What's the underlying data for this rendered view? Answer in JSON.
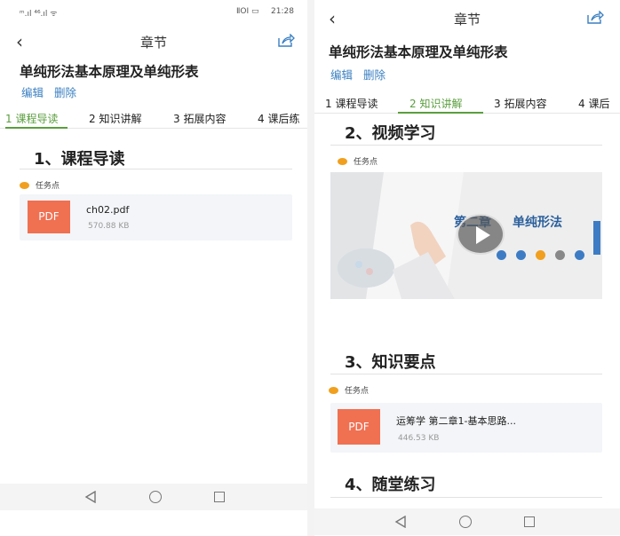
{
  "left": {
    "status": {
      "left_icons": "ᵐ.ıl ⁴⁶.ıl ᯤ",
      "right_icons": "ⅡOI ▭",
      "time": "21:28"
    },
    "header": {
      "title": "章节"
    },
    "chapter": {
      "title": "单纯形法基本原理及单纯形表",
      "edit": "编辑",
      "delete": "删除"
    },
    "tabs": [
      "1 课程导读",
      "2 知识讲解",
      "3 拓展内容",
      "4 课后练"
    ],
    "section": {
      "heading": "1、课程导读",
      "task": "任务点",
      "file": {
        "badge": "PDF",
        "name": "ch02.pdf",
        "size": "570.88 KB"
      }
    }
  },
  "right": {
    "header": {
      "title": "章节"
    },
    "chapter": {
      "title": "单纯形法基本原理及单纯形表",
      "edit": "编辑",
      "delete": "删除"
    },
    "tabs": [
      "1 课程导读",
      "2 知识讲解",
      "3 拓展内容",
      "4 课后"
    ],
    "video_section": {
      "heading": "2、视频学习",
      "task": "任务点",
      "video": {
        "text_a": "第二章",
        "text_b": "单纯形法"
      }
    },
    "knowledge_section": {
      "heading": "3、知识要点",
      "task": "任务点",
      "file": {
        "badge": "PDF",
        "name": "运筹学 第二章1-基本思路...",
        "size": "446.53 KB"
      }
    },
    "practice_section": {
      "heading": "4、随堂练习"
    }
  },
  "colors": {
    "accent_green": "#5a9e3e",
    "link_blue": "#3a7fc1",
    "pdf_red": "#f07052",
    "task_orange": "#f0a01e"
  },
  "icons": [
    "back-arrow-icon",
    "share-icon",
    "play-icon",
    "nav-back-icon",
    "nav-home-icon",
    "nav-recent-icon"
  ]
}
